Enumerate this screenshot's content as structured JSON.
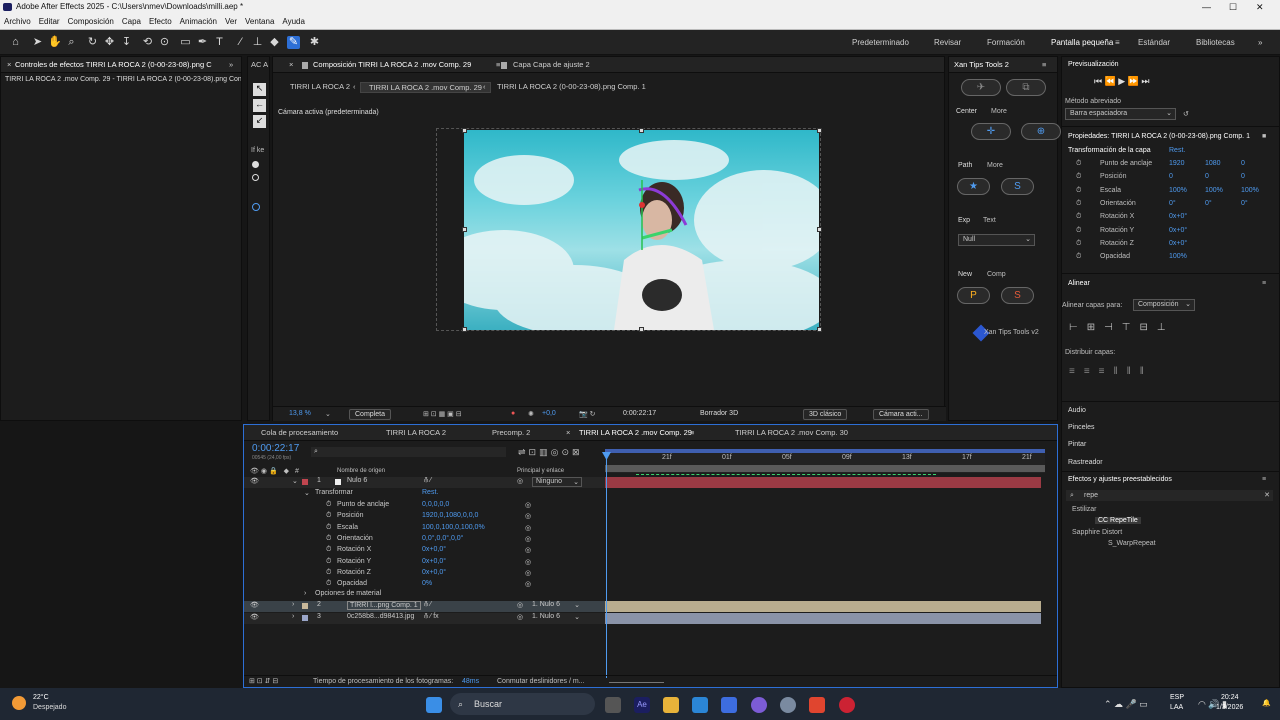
{
  "window": {
    "title": "Adobe After Effects 2025 - C:\\Users\\nmev\\Downloads\\milli.aep *"
  },
  "menu": [
    "Archivo",
    "Editar",
    "Composición",
    "Capa",
    "Efecto",
    "Animación",
    "Ver",
    "Ventana",
    "Ayuda"
  ],
  "workspaces": [
    "Predeterminado",
    "Revisar",
    "Formación",
    "Pantalla pequeña",
    "Estándar",
    "Bibliotecas"
  ],
  "effects_panel": {
    "tab": "Controles de efectos TIRRI LA ROCA 2 (0-00-23-08).png C",
    "line": "TIRRI LA ROCA 2 .mov Comp. 29 - TIRRI LA ROCA 2 (0-00-23-08).png Con",
    "side_tab": "AC A",
    "side_texts": [
      "If ke",
      "",
      ""
    ]
  },
  "comp_panel": {
    "tab_main": "Composición TIRRI LA ROCA 2 .mov Comp. 29",
    "tab_other": "Capa Capa de ajuste 2",
    "breadcrumbs": [
      "TIRRI LA ROCA 2",
      "TIRRI LA ROCA 2 .mov Comp. 29",
      "TIRRI LA ROCA 2 (0-00-23-08).png Comp. 1"
    ],
    "camera_label": "Cámara activa (predeterminada)",
    "zoom": "13,8 %",
    "quality": "Completa",
    "exposure": "+0,0",
    "timecode": "0:00:22:17",
    "render": "Borrador 3D",
    "view_3d": "3D clásico",
    "camera_menu": "Cámara acti..."
  },
  "xan_panel": {
    "tab": "Xan Tips Tools 2",
    "labels": [
      "Center",
      "More",
      "Path",
      "More",
      "Exp",
      "Text",
      "New",
      "Comp"
    ],
    "null_dropdown": "Null",
    "letters": [
      "P",
      "S"
    ],
    "brand": "Xan Tips Tools v2"
  },
  "preview": {
    "title": "Previsualización",
    "method_label": "Método abreviado",
    "method_value": "Barra espaciadora"
  },
  "properties": {
    "title": "Propiedades: TIRRI LA ROCA 2 (0-00-23-08).png Comp. 1",
    "section": "Transformación de la capa",
    "reset": "Rest.",
    "rows": [
      {
        "label": "Punto de anclaje",
        "v1": "1920",
        "v2": "1080",
        "v3": "0"
      },
      {
        "label": "Posición",
        "v1": "0",
        "v2": "0",
        "v3": "0"
      },
      {
        "label": "Escala",
        "v1": "100%",
        "v2": "100%",
        "v3": "100%"
      },
      {
        "label": "Orientación",
        "v1": "0°",
        "v2": "0°",
        "v3": "0°"
      },
      {
        "label": "Rotación X",
        "v1": "0x+0°",
        "v2": "",
        "v3": ""
      },
      {
        "label": "Rotación Y",
        "v1": "0x+0°",
        "v2": "",
        "v3": ""
      },
      {
        "label": "Rotación Z",
        "v1": "0x+0°",
        "v2": "",
        "v3": ""
      },
      {
        "label": "Opacidad",
        "v1": "100%",
        "v2": "",
        "v3": ""
      }
    ]
  },
  "align": {
    "title": "Alinear",
    "label": "Alinear capas para:",
    "target": "Composición",
    "distribute": "Distribuir capas:"
  },
  "side_sections": [
    "Audio",
    "Pinceles",
    "Pintar",
    "Rastreador"
  ],
  "effects_presets": {
    "title": "Efectos y ajustes preestablecidos",
    "search": "repe",
    "groups": [
      {
        "name": "Estilizar",
        "item": "CC RepeTile"
      },
      {
        "name": "Sapphire Distort",
        "item": "S_WarpRepeat"
      }
    ]
  },
  "timeline": {
    "tabs": [
      "Cola de procesamiento",
      "TIRRI LA ROCA 2",
      "Precomp. 2",
      "TIRRI LA ROCA 2 .mov Comp. 29",
      "TIRRI LA ROCA 2 .mov Comp. 30"
    ],
    "timecode": "0:00:22:17",
    "fps": "00545 (24,00 fps)",
    "col_source": "Nombre de origen",
    "col_parent": "Principal y enlace",
    "ruler": [
      "21f",
      "01f",
      "05f",
      "09f",
      "13f",
      "17f",
      "21f"
    ],
    "layers": [
      {
        "num": "1",
        "name": "Nulo 6",
        "parent": "Ninguno"
      },
      {
        "num": "2",
        "name": "TIRRI l...png Comp. 1",
        "parent": "1. Nulo 6"
      },
      {
        "num": "3",
        "name": "0c258b8...d98413.jpg",
        "parent": "1. Nulo 6"
      }
    ],
    "transform": {
      "title": "Transformar",
      "reset": "Rest.",
      "props": [
        {
          "label": "Punto de anclaje",
          "value": "0,0,0,0,0"
        },
        {
          "label": "Posición",
          "value": "1920,0,1080,0,0,0"
        },
        {
          "label": "Escala",
          "value": "100,0,100,0,100,0%"
        },
        {
          "label": "Orientación",
          "value": "0,0°,0,0°,0,0°"
        },
        {
          "label": "Rotación X",
          "value": "0x+0,0°"
        },
        {
          "label": "Rotación Y",
          "value": "0x+0,0°"
        },
        {
          "label": "Rotación Z",
          "value": "0x+0,0°"
        },
        {
          "label": "Opacidad",
          "value": "0%"
        }
      ],
      "materials": "Opciones de material"
    },
    "status": "Tiempo de procesamiento de los fotogramas:",
    "status_value": "48ms",
    "toggle": "Conmutar deslinidores / m..."
  },
  "taskbar": {
    "temp": "22°C",
    "weather": "Despejado",
    "search": "Buscar",
    "lang": "ESP",
    "lang2": "LAA",
    "time": "20:24",
    "date": "1/3/2026"
  }
}
